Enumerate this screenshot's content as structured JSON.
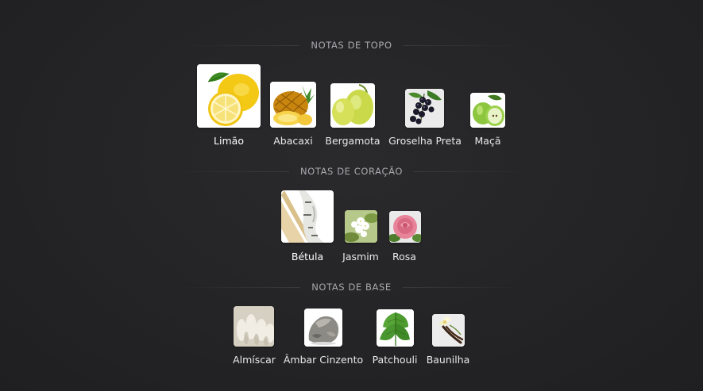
{
  "sections": {
    "top": {
      "title": "NOTAS DE TOPO",
      "notes": [
        {
          "label": "Limão",
          "icon": "lemon-icon"
        },
        {
          "label": "Abacaxi",
          "icon": "pineapple-icon"
        },
        {
          "label": "Bergamota",
          "icon": "bergamot-icon"
        },
        {
          "label": "Groselha Preta",
          "icon": "blackcurrant-icon"
        },
        {
          "label": "Maçã",
          "icon": "apple-icon"
        }
      ]
    },
    "heart": {
      "title": "NOTAS DE CORAÇÃO",
      "notes": [
        {
          "label": "Bétula",
          "icon": "birch-icon"
        },
        {
          "label": "Jasmim",
          "icon": "jasmine-icon"
        },
        {
          "label": "Rosa",
          "icon": "rose-icon"
        }
      ]
    },
    "base": {
      "title": "NOTAS DE BASE",
      "notes": [
        {
          "label": "Almíscar",
          "icon": "musk-icon"
        },
        {
          "label": "Âmbar Cinzento",
          "icon": "ambergris-icon"
        },
        {
          "label": "Patchouli",
          "icon": "patchouli-icon"
        },
        {
          "label": "Baunilha",
          "icon": "vanilla-icon"
        }
      ]
    }
  }
}
